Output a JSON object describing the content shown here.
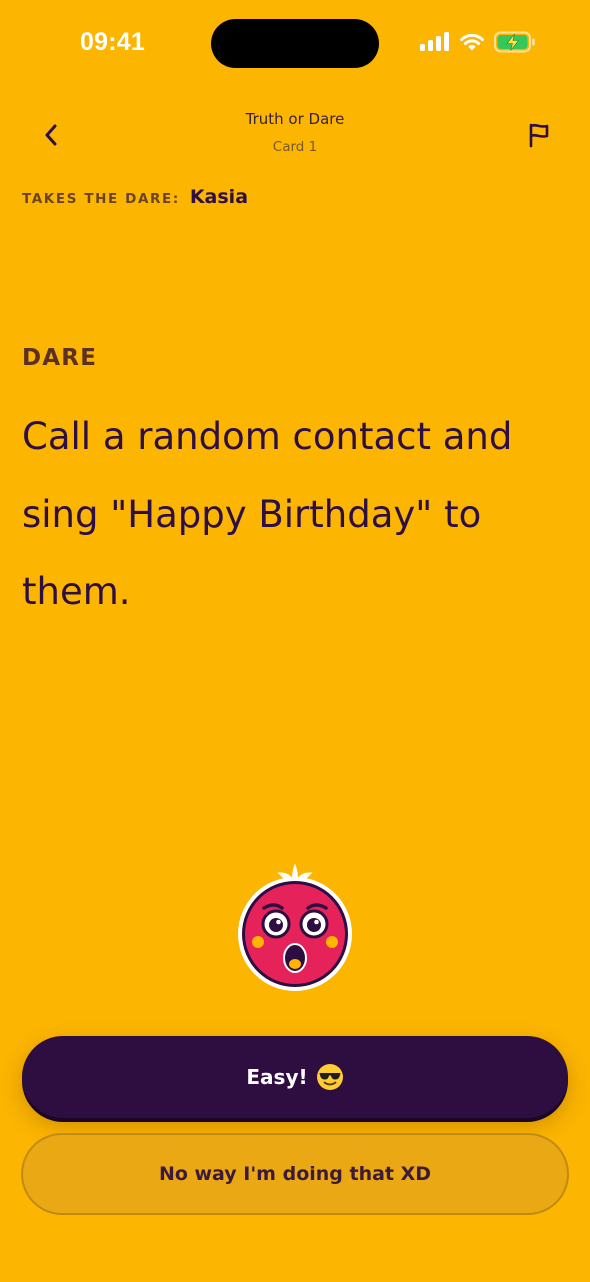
{
  "status_bar": {
    "time": "09:41",
    "icons": [
      "signal-icon",
      "wifi-icon",
      "battery-charging-icon"
    ]
  },
  "nav": {
    "title": "Truth or Dare",
    "subtitle": "Card 1",
    "back_icon": "chevron-left-icon",
    "report_icon": "flag-icon"
  },
  "player": {
    "label": "TAKES THE DARE:",
    "name": "Kasia"
  },
  "card": {
    "type": "DARE",
    "text": "Call a random contact and sing \"Happy Birthday\" to them."
  },
  "mascot": {
    "icon": "surprised-face-mascot-icon"
  },
  "actions": {
    "accept_label": "Easy!",
    "accept_emoji": "sunglasses-face-icon",
    "decline_label": "No way I'm doing that XD"
  },
  "colors": {
    "background": "#FCB501",
    "primary_dark": "#2E0E41",
    "mascot_pink": "#E6225B"
  }
}
